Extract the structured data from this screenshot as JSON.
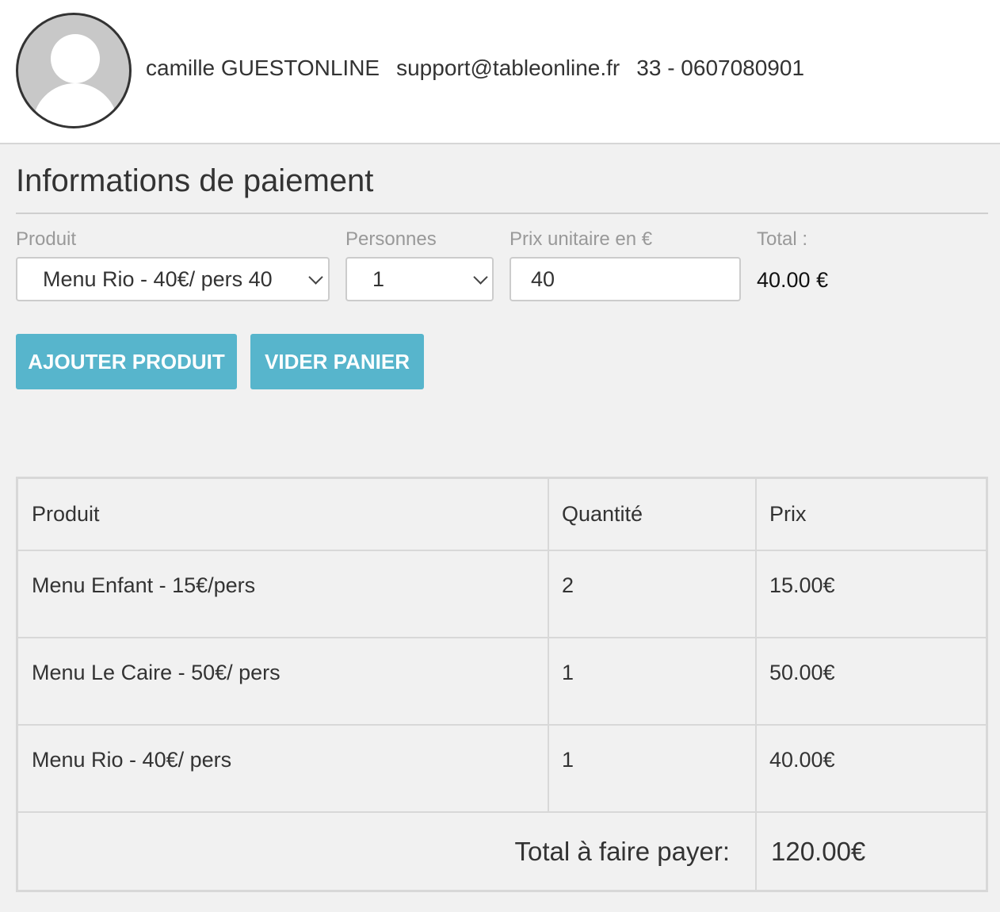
{
  "user": {
    "name": "camille GUESTONLINE",
    "email": "support@tableonline.fr",
    "phone": "33 - 0607080901"
  },
  "payment": {
    "title": "Informations de paiement",
    "form": {
      "product_label": "Produit",
      "product_value": "Menu Rio - 40€/ pers 40",
      "persons_label": "Personnes",
      "persons_value": "1",
      "unit_price_label": "Prix unitaire en €",
      "unit_price_value": "40",
      "total_label": "Total :",
      "total_value": "40.00 €"
    },
    "buttons": {
      "add": "AJOUTER PRODUIT",
      "clear": "VIDER PANIER"
    }
  },
  "cart": {
    "headers": [
      "Produit",
      "Quantité",
      "Prix"
    ],
    "rows": [
      [
        "Menu Enfant - 15€/pers",
        "2",
        "15.00€"
      ],
      [
        "Menu Le Caire - 50€/ pers",
        "1",
        "50.00€"
      ],
      [
        "Menu Rio - 40€/ pers",
        "1",
        "40.00€"
      ]
    ],
    "total_label": "Total à faire payer:",
    "total_value": "120.00€"
  },
  "colors": {
    "button": "#57b5cc",
    "page_background": "#f1f1f1"
  },
  "icons": [
    "user-avatar-icon",
    "chevron-down-icon"
  ]
}
